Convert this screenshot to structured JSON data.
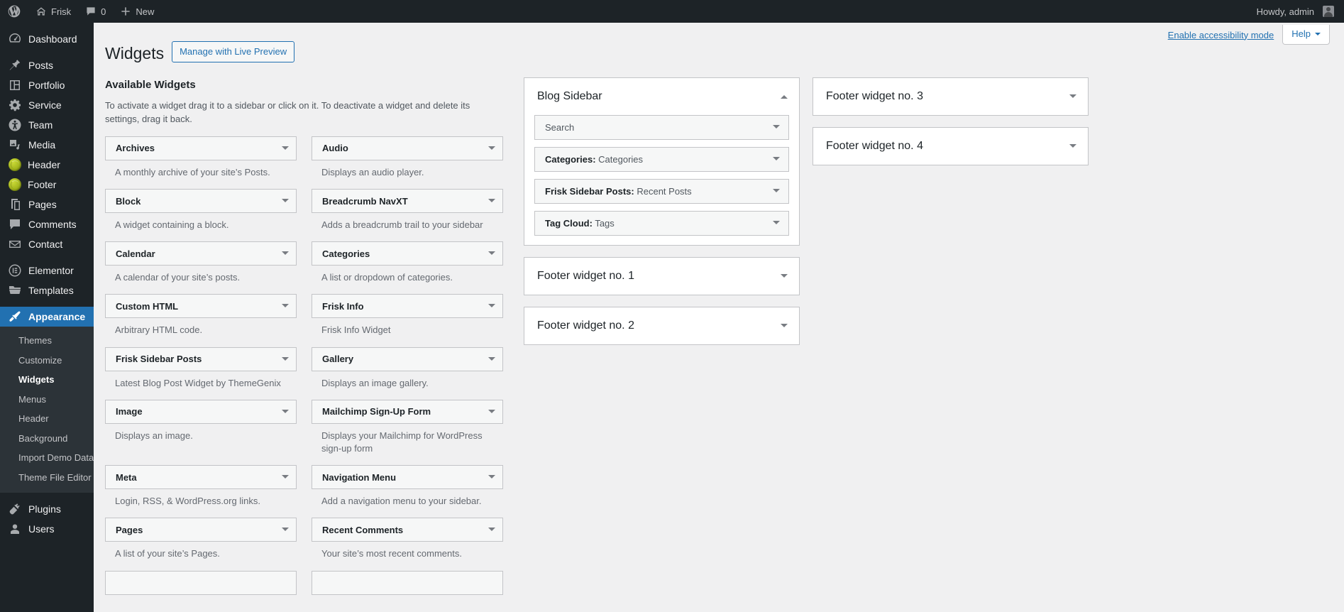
{
  "adminbar": {
    "logo_icon": "wordpress-logo-icon",
    "site_name": "Frisk",
    "site_icon": "home-icon",
    "comments_icon": "comment-bubble-icon",
    "comments_count": "0",
    "new_icon": "plus-icon",
    "new_label": "New",
    "howdy": "Howdy, admin",
    "avatar_icon": "user-avatar"
  },
  "menu": [
    {
      "label": "Dashboard",
      "icon": "dashboard-icon",
      "type": "icon",
      "sep_after": true
    },
    {
      "label": "Posts",
      "icon": "pin-icon",
      "type": "icon"
    },
    {
      "label": "Portfolio",
      "icon": "portfolio-icon",
      "type": "icon"
    },
    {
      "label": "Service",
      "icon": "gear-icon",
      "type": "icon"
    },
    {
      "label": "Team",
      "icon": "accessibility-person-icon",
      "type": "icon"
    },
    {
      "label": "Media",
      "icon": "media-icon",
      "type": "icon"
    },
    {
      "label": "Header",
      "icon": "green-ball-icon",
      "type": "ball"
    },
    {
      "label": "Footer",
      "icon": "green-ball-icon",
      "type": "ball"
    },
    {
      "label": "Pages",
      "icon": "pages-icon",
      "type": "icon"
    },
    {
      "label": "Comments",
      "icon": "comment-bubble-icon",
      "type": "icon"
    },
    {
      "label": "Contact",
      "icon": "envelope-icon",
      "type": "icon",
      "sep_after": true
    },
    {
      "label": "Elementor",
      "icon": "elementor-icon",
      "type": "icon"
    },
    {
      "label": "Templates",
      "icon": "folder-icon",
      "type": "icon",
      "sep_after": true
    }
  ],
  "appearance": {
    "label": "Appearance",
    "icon": "paintbrush-icon",
    "submenu": [
      {
        "label": "Themes",
        "current": false
      },
      {
        "label": "Customize",
        "current": false
      },
      {
        "label": "Widgets",
        "current": true
      },
      {
        "label": "Menus",
        "current": false
      },
      {
        "label": "Header",
        "current": false
      },
      {
        "label": "Background",
        "current": false
      },
      {
        "label": "Import Demo Data",
        "current": false
      },
      {
        "label": "Theme File Editor",
        "current": false
      }
    ]
  },
  "menu_after": [
    {
      "label": "Plugins",
      "icon": "plug-icon",
      "type": "icon"
    },
    {
      "label": "Users",
      "icon": "user-icon",
      "type": "icon"
    }
  ],
  "screen_meta": {
    "accessibility_link": "Enable accessibility mode",
    "help_label": "Help",
    "help_caret_icon": "caret-down-icon"
  },
  "header": {
    "page_title": "Widgets",
    "live_preview_button": "Manage with Live Preview"
  },
  "available": {
    "heading": "Available Widgets",
    "description": "To activate a widget drag it to a sidebar or click on it. To deactivate a widget and delete its settings, drag it back.",
    "toggle_icon": "caret-down-icon",
    "widgets": [
      {
        "title": "Archives",
        "desc": "A monthly archive of your site’s Posts."
      },
      {
        "title": "Audio",
        "desc": "Displays an audio player."
      },
      {
        "title": "Block",
        "desc": "A widget containing a block."
      },
      {
        "title": "Breadcrumb NavXT",
        "desc": "Adds a breadcrumb trail to your sidebar"
      },
      {
        "title": "Calendar",
        "desc": "A calendar of your site’s posts."
      },
      {
        "title": "Categories",
        "desc": "A list or dropdown of categories."
      },
      {
        "title": "Custom HTML",
        "desc": "Arbitrary HTML code."
      },
      {
        "title": "Frisk Info",
        "desc": "Frisk Info Widget"
      },
      {
        "title": "Frisk Sidebar Posts",
        "desc": "Latest Blog Post Widget by ThemeGenix"
      },
      {
        "title": "Gallery",
        "desc": "Displays an image gallery."
      },
      {
        "title": "Image",
        "desc": "Displays an image."
      },
      {
        "title": "Mailchimp Sign-Up Form",
        "desc": "Displays your Mailchimp for WordPress sign-up form"
      },
      {
        "title": "Meta",
        "desc": "Login, RSS, & WordPress.org links."
      },
      {
        "title": "Navigation Menu",
        "desc": "Add a navigation menu to your sidebar."
      },
      {
        "title": "Pages",
        "desc": "A list of your site’s Pages."
      },
      {
        "title": "Recent Comments",
        "desc": "Your site’s most recent comments."
      },
      {
        "title": "",
        "desc": ""
      },
      {
        "title": "",
        "desc": ""
      }
    ]
  },
  "sidebars_col1": [
    {
      "name": "Blog Sidebar",
      "expanded": true,
      "toggle_icon": "caret-up-icon",
      "widgets": [
        {
          "name": "",
          "instance": "Search"
        },
        {
          "name": "Categories:",
          "instance": "Categories"
        },
        {
          "name": "Frisk Sidebar Posts:",
          "instance": "Recent Posts"
        },
        {
          "name": "Tag Cloud:",
          "instance": "Tags"
        }
      ]
    },
    {
      "name": "Footer widget no. 1",
      "expanded": false,
      "toggle_icon": "caret-down-icon",
      "widgets": []
    },
    {
      "name": "Footer widget no. 2",
      "expanded": false,
      "toggle_icon": "caret-down-icon",
      "widgets": []
    }
  ],
  "sidebars_col2": [
    {
      "name": "Footer widget no. 3",
      "expanded": false,
      "toggle_icon": "caret-down-icon",
      "widgets": []
    },
    {
      "name": "Footer widget no. 4",
      "expanded": false,
      "toggle_icon": "caret-down-icon",
      "widgets": []
    }
  ],
  "colors": {
    "admin_dark": "#1d2327",
    "admin_submenu": "#2c3338",
    "accent_blue": "#2271b1",
    "content_bg": "#f0f0f1",
    "widget_bg": "#f6f7f7",
    "border": "#c3c4c7",
    "ball_green": "#aabf1c"
  }
}
